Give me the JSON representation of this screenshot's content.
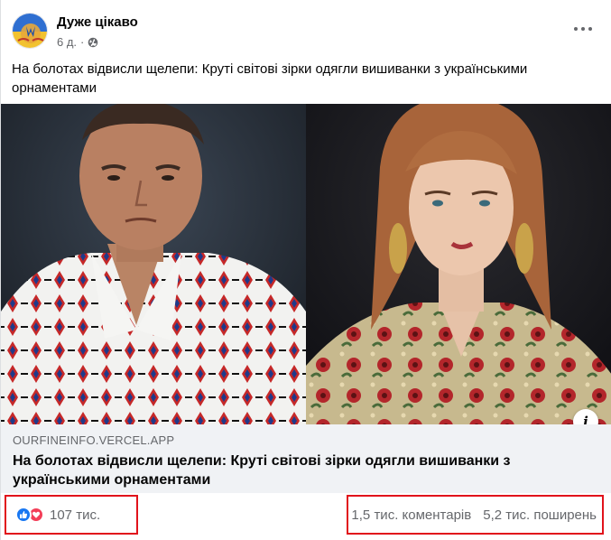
{
  "post": {
    "page_name": "Дуже цікаво",
    "time": "6 д.",
    "separator": "·",
    "privacy_icon": "globe-icon",
    "more_icon": "more-dots-icon",
    "text": "На болотах відвисли щелепи: Круті світові зірки одягли вишиванки з українськими орнаментами"
  },
  "link_preview": {
    "domain": "OURFINEINFO.VERCEL.APP",
    "title": "На болотах відвисли щелепи: Круті світові зірки одягли вишиванки з українськими орнаментами",
    "info_label": "i"
  },
  "engagement": {
    "reaction_icons": [
      "like-icon",
      "love-icon"
    ],
    "reactions_count": "107 тис.",
    "comments": "1,5 тис. коментарів",
    "shares": "5,2 тис. поширень"
  },
  "colors": {
    "highlight_box": "#e1131b",
    "like": "#1877f2",
    "love": "#f33e58"
  }
}
